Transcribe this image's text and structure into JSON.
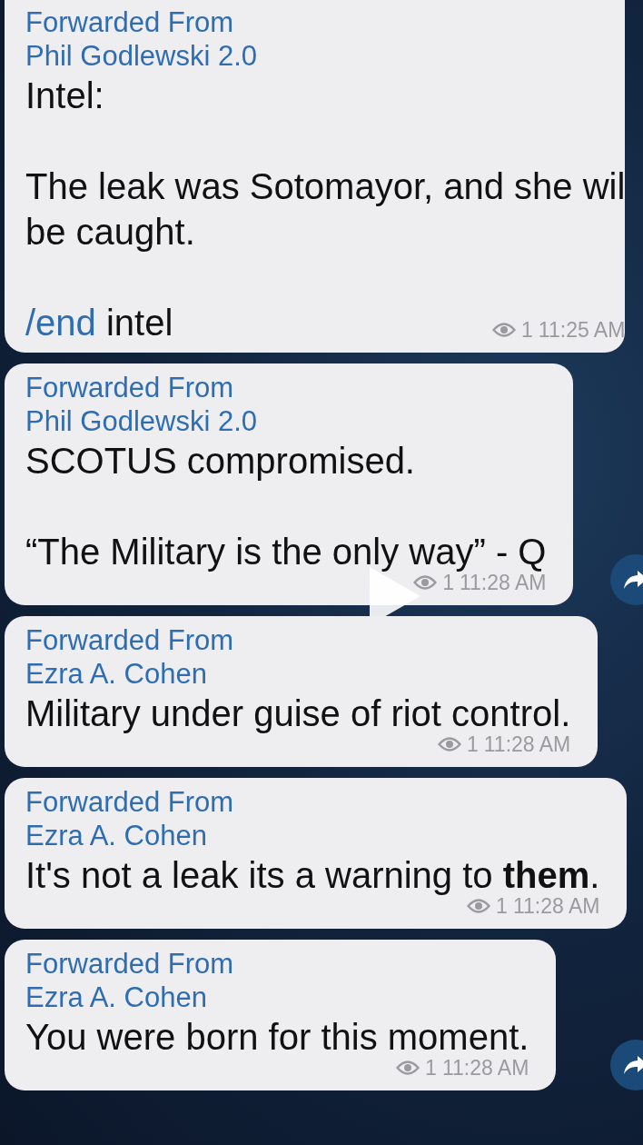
{
  "video": {
    "play_button": true
  },
  "messages": [
    {
      "forwarded_label": "Forwarded From",
      "sender": "Phil Godlewski 2.0",
      "paragraphs": [
        {
          "parts": [
            {
              "kind": "plain",
              "text": "Intel:"
            }
          ]
        },
        {
          "parts": [
            {
              "kind": "plain",
              "text": "The leak was Sotomayor, and she wil\nbe caught."
            }
          ]
        },
        {
          "parts": [
            {
              "kind": "command",
              "text": "/end"
            },
            {
              "kind": "plain",
              "text": " intel"
            }
          ]
        }
      ],
      "views": "1",
      "time": "11:25 AM",
      "cut_top": true,
      "forward_button": false
    },
    {
      "forwarded_label": "Forwarded From",
      "sender": "Phil Godlewski 2.0",
      "paragraphs": [
        {
          "parts": [
            {
              "kind": "plain",
              "text": "SCOTUS compromised."
            }
          ]
        },
        {
          "parts": [
            {
              "kind": "plain",
              "text": "“The Military is the only way” - Q"
            }
          ]
        }
      ],
      "views": "1",
      "time": "11:28 AM",
      "cut_top": false,
      "forward_button": true
    },
    {
      "forwarded_label": "Forwarded From",
      "sender": "Ezra A. Cohen",
      "paragraphs": [
        {
          "parts": [
            {
              "kind": "plain",
              "text": "Military under guise of riot control."
            }
          ]
        }
      ],
      "views": "1",
      "time": "11:28 AM",
      "cut_top": false,
      "forward_button": false
    },
    {
      "forwarded_label": "Forwarded From",
      "sender": "Ezra A. Cohen",
      "paragraphs": [
        {
          "parts": [
            {
              "kind": "plain",
              "text": "It's not a leak its a warning to **them**."
            }
          ]
        }
      ],
      "views": "1",
      "time": "11:28 AM",
      "cut_top": false,
      "forward_button": false
    },
    {
      "forwarded_label": "Forwarded From",
      "sender": "Ezra A. Cohen",
      "paragraphs": [
        {
          "parts": [
            {
              "kind": "plain",
              "text": "You were born for this moment."
            }
          ]
        }
      ],
      "views": "1",
      "time": "11:28 AM",
      "cut_top": false,
      "forward_button": true
    }
  ]
}
